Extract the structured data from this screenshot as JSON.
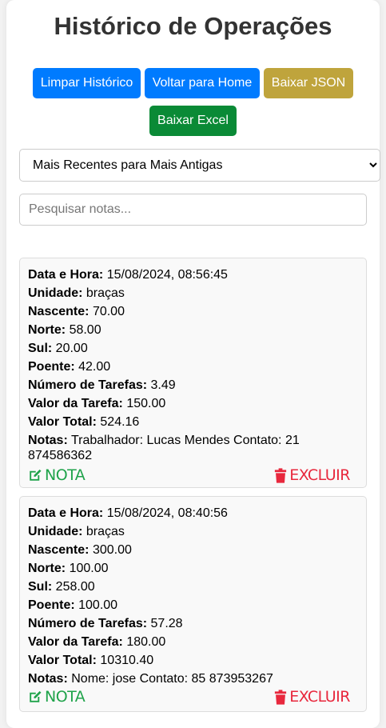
{
  "page": {
    "title": "Histórico de Operações"
  },
  "toolbar": {
    "clear_label": "Limpar Histórico",
    "home_label": "Voltar para Home",
    "json_label": "Baixar JSON",
    "excel_label": "Baixar Excel"
  },
  "sort": {
    "selected": "Mais Recentes para Mais Antigas"
  },
  "search": {
    "placeholder": "Pesquisar notas..."
  },
  "labels": {
    "datetime": "Data e Hora:",
    "unit": "Unidade:",
    "nascente": "Nascente:",
    "norte": "Norte:",
    "sul": "Sul:",
    "poente": "Poente:",
    "tasks": "Número de Tarefas:",
    "task_value": "Valor da Tarefa:",
    "total": "Valor Total:",
    "notes": "Notas:",
    "note_action": "NOTA",
    "delete_action": "EXCLUIR"
  },
  "colors": {
    "blue_button": "#007bff",
    "gold_button": "#bfa43c",
    "green_button": "#0a8a36",
    "note_action": "#1fa34a",
    "delete_action": "#e8283d"
  },
  "icons": {
    "note": "edit-icon",
    "delete": "trash-icon"
  },
  "records": [
    {
      "datetime": "15/08/2024, 08:56:45",
      "unit": "braças",
      "nascente": "70.00",
      "norte": "58.00",
      "sul": "20.00",
      "poente": "42.00",
      "tasks": "3.49",
      "task_value": "150.00",
      "total": "524.16",
      "notes": "Trabalhador: Lucas Mendes Contato: 21 874586362"
    },
    {
      "datetime": "15/08/2024, 08:40:56",
      "unit": "braças",
      "nascente": "300.00",
      "norte": "100.00",
      "sul": "258.00",
      "poente": "100.00",
      "tasks": "57.28",
      "task_value": "180.00",
      "total": "10310.40",
      "notes": "Nome: jose Contato: 85 873953267"
    }
  ]
}
